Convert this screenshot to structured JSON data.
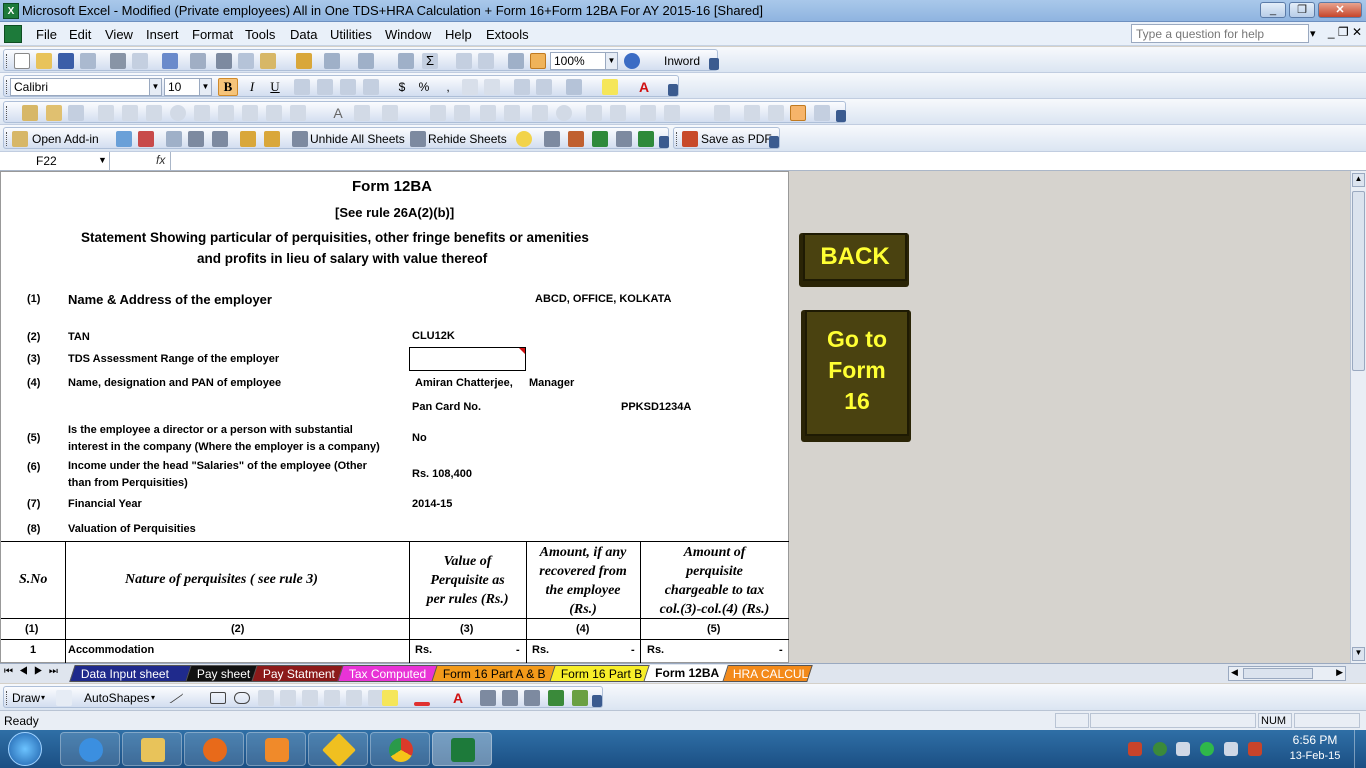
{
  "window": {
    "title": "Microsoft Excel - Modified (Private employees)  All in One TDS+HRA Calculation + Form 16+Form 12BA For AY 2015-16  [Shared]",
    "minimize": "_",
    "restore": "❐",
    "close": "✕"
  },
  "menu": {
    "items": [
      "File",
      "Edit",
      "View",
      "Insert",
      "Format",
      "Tools",
      "Data",
      "Utilities",
      "Window",
      "Help",
      "Extools"
    ],
    "help_placeholder": "Type a question for help"
  },
  "toolbar": {
    "zoom": "100%",
    "inword": "Inword",
    "font": "Calibri",
    "font_size": "10",
    "bold": "B",
    "italic": "I",
    "underline": "U",
    "open_addin": "Open Add-in",
    "unhide": "Unhide All Sheets",
    "rehide": "Rehide Sheets",
    "save_pdf": "Save as PDF"
  },
  "formula": {
    "cell_ref": "F22",
    "fx": "fx"
  },
  "form": {
    "title": "Form 12BA",
    "rule": "[See rule 26A(2)(b)]",
    "statement1": "Statement Showing particular of perquisities, other fringe benefits or amenities",
    "statement2": "and profits in lieu of salary with value thereof",
    "r1_no": "(1)",
    "r1_label": "Name & Address of the employer",
    "r1_value": "ABCD, OFFICE, KOLKATA",
    "r2_no": "(2)",
    "r2_label": "TAN",
    "r2_value": "CLU12K",
    "r3_no": "(3)",
    "r3_label": "TDS Assessment Range of the employer",
    "r4_no": "(4)",
    "r4_label": "Name, designation and PAN of employee",
    "r4_name": "Amiran Chatterjee,",
    "r4_desig": "Manager",
    "pan_label": "Pan Card No.",
    "pan_value": "PPKSD1234A",
    "r5_no": "(5)",
    "r5_label1": "Is the employee a director or a person with substantial",
    "r5_label2": "interest in the company (Where the employer is a company)",
    "r5_value": "No",
    "r6_no": "(6)",
    "r6_label1": "Income under the head \"Salaries\" of the employee (Other",
    "r6_label2": "than from Perquisities)",
    "r6_value": "Rs. 108,400",
    "r7_no": "(7)",
    "r7_label": "Financial Year",
    "r7_value": "2014-15",
    "r8_no": "(8)",
    "r8_label": "Valuation of Perquisities"
  },
  "table": {
    "h1": "S.No",
    "h2": "Nature of perquisites ( see rule 3)",
    "h3": [
      "Value of",
      "Perquisite as",
      "per rules (Rs.)"
    ],
    "h4": [
      "Amount, if any",
      "recovered from",
      "the employee",
      "(Rs.)"
    ],
    "h5": [
      "Amount of",
      "perquisite",
      "chargeable to tax",
      "col.(3)-col.(4) (Rs.)"
    ],
    "cols": [
      "(1)",
      "(2)",
      "(3)",
      "(4)",
      "(5)"
    ],
    "row1": {
      "sno": "1",
      "nature": "Accommodation",
      "rs3": "Rs.",
      "v3": "-",
      "rs4": "Rs.",
      "v4": "-",
      "rs5": "Rs.",
      "v5": "-"
    }
  },
  "buttons": {
    "back": "BACK",
    "goto": [
      "Go to",
      "Form",
      "16"
    ]
  },
  "tabs": [
    {
      "label": "Data Input sheet",
      "bg": "#1f2a8c",
      "fg": "#ffffff"
    },
    {
      "label": "Pay sheet",
      "bg": "#111111",
      "fg": "#ffffff"
    },
    {
      "label": "Pay Statment",
      "bg": "#8c1a1a",
      "fg": "#ffffff"
    },
    {
      "label": "Tax Computed",
      "bg": "#e833d6",
      "fg": "#ffffff"
    },
    {
      "label": "Form 16 Part A & B",
      "bg": "#f39a1a",
      "fg": "#000000"
    },
    {
      "label": "Form 16 Part B",
      "bg": "#f7ee2a",
      "fg": "#000000"
    },
    {
      "label": "Form 12BA",
      "bg": "#ffffff",
      "fg": "#000000"
    },
    {
      "label": "HRA CALCUL",
      "bg": "#f38a1a",
      "fg": "#ffffff"
    }
  ],
  "draw": {
    "draw": "Draw",
    "autoshapes": "AutoShapes"
  },
  "status": {
    "ready": "Ready",
    "num": "NUM"
  },
  "clock": {
    "time": "6:56 PM",
    "date": "13-Feb-15"
  }
}
